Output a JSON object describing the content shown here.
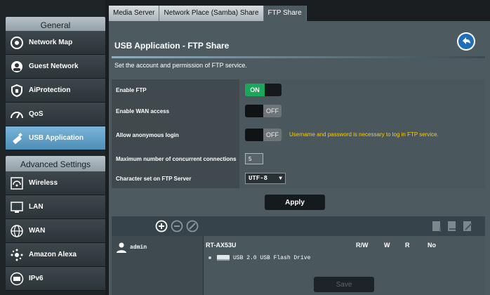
{
  "sidebar": {
    "general_header": "General",
    "advanced_header": "Advanced Settings",
    "general_items": [
      {
        "label": "Network Map",
        "icon": "network-map-icon"
      },
      {
        "label": "Guest Network",
        "icon": "guest-network-icon"
      },
      {
        "label": "AiProtection",
        "icon": "aiprotection-lock-icon"
      },
      {
        "label": "QoS",
        "icon": "qos-gauge-icon"
      },
      {
        "label": "USB Application",
        "icon": "usb-application-icon",
        "active": true
      }
    ],
    "advanced_items": [
      {
        "label": "Wireless",
        "icon": "wireless-icon"
      },
      {
        "label": "LAN",
        "icon": "lan-icon"
      },
      {
        "label": "WAN",
        "icon": "wan-globe-icon"
      },
      {
        "label": "Amazon Alexa",
        "icon": "amazon-alexa-icon"
      },
      {
        "label": "IPv6",
        "icon": "ipv6-icon"
      }
    ]
  },
  "tabs": [
    {
      "label": "Media Server",
      "active": false
    },
    {
      "label": "Network Place (Samba) Share",
      "active": false
    },
    {
      "label": "FTP Share",
      "active": true
    }
  ],
  "page": {
    "title": "USB Application - FTP Share",
    "description": "Set the account and permission of FTP service."
  },
  "settings": {
    "enable_ftp": {
      "label": "Enable FTP",
      "state": "ON"
    },
    "enable_wan": {
      "label": "Enable WAN access",
      "state": "OFF"
    },
    "anonymous": {
      "label": "Allow anonymous login",
      "state": "OFF",
      "note": "Username and password is necessary to log in FTP service."
    },
    "max_conn": {
      "label": "Maximum number of concurrent connections",
      "value": "5"
    },
    "charset": {
      "label": "Character set on FTP Server",
      "value": "UTF-8"
    }
  },
  "buttons": {
    "apply": "Apply",
    "save": "Save"
  },
  "share": {
    "account": "admin",
    "device": "RT-AX53U",
    "perm_rw": "R/W",
    "perm_w": "W",
    "perm_r": "R",
    "perm_no": "No",
    "drive": "USB 2.0 USB Flash Drive"
  },
  "colors": {
    "accent": "#1aa85a",
    "warning": "#ffcc00",
    "active_nav": "#6aa6cf"
  }
}
